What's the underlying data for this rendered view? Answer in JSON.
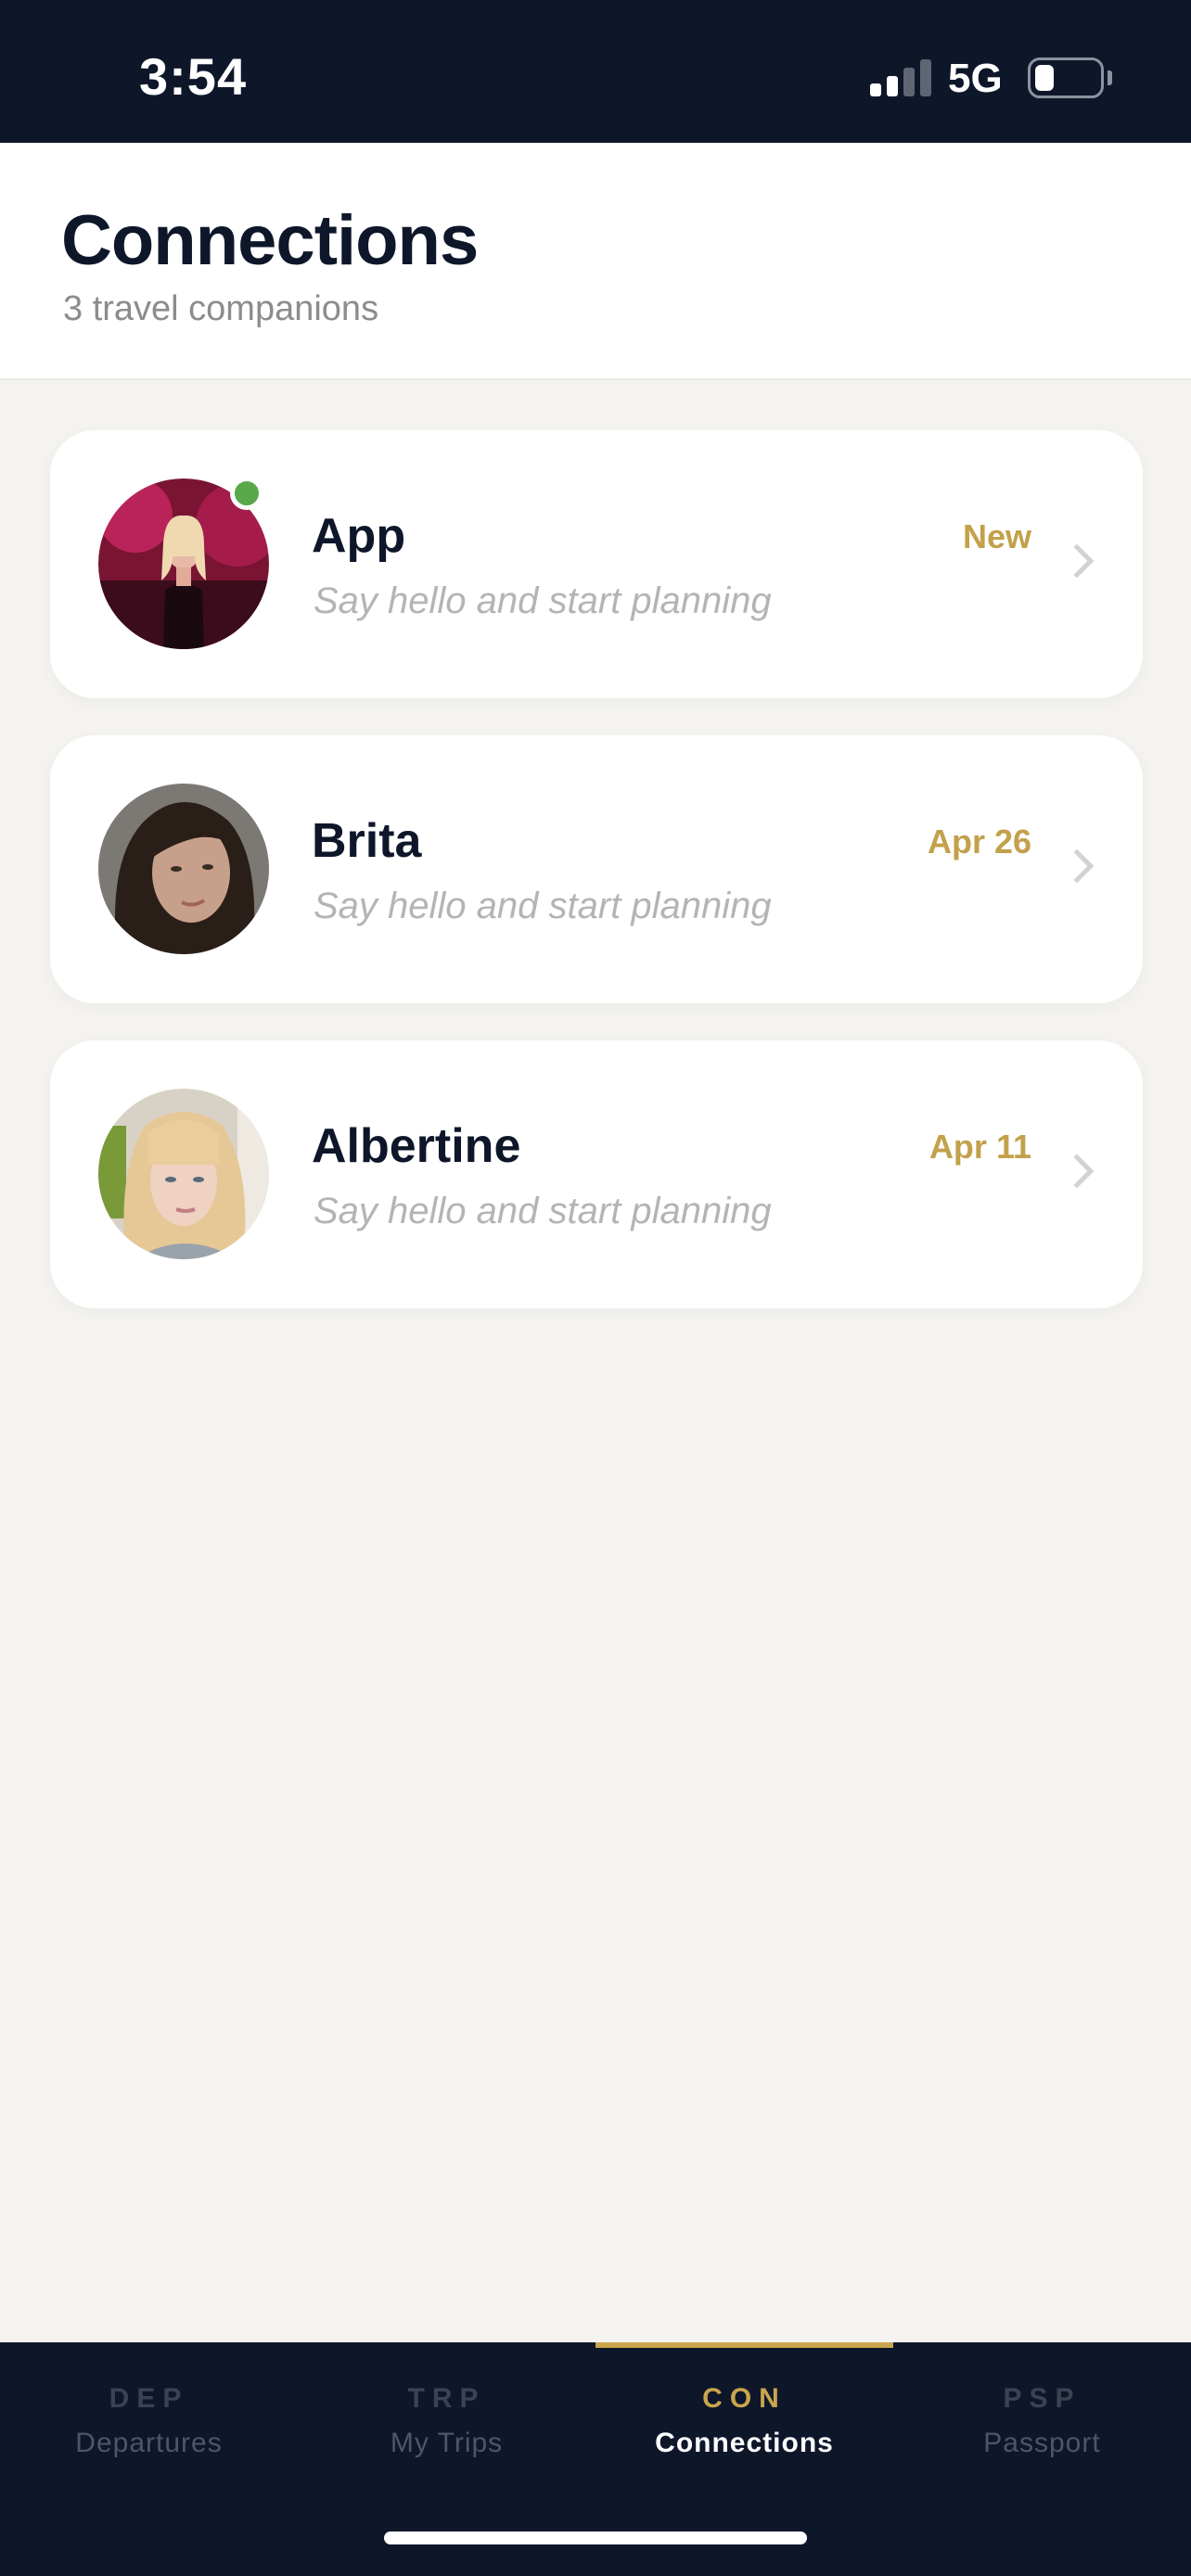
{
  "status_bar": {
    "time": "3:54",
    "network": "5G",
    "battery_level": 0.3
  },
  "header": {
    "title": "Connections",
    "subtitle": "3 travel companions"
  },
  "connections": [
    {
      "name": "App",
      "snippet": "Say hello and start planning",
      "date": "New",
      "online": true,
      "avatar": "person-portrait-pink-backdrop"
    },
    {
      "name": "Brita",
      "snippet": "Say hello and start planning",
      "date": "Apr 26",
      "online": false,
      "avatar": "person-portrait-dark-hair"
    },
    {
      "name": "Albertine",
      "snippet": "Say hello and start planning",
      "date": "Apr 11",
      "online": false,
      "avatar": "person-portrait-blonde-hair"
    }
  ],
  "tabbar": {
    "tabs": [
      {
        "code": "DEP",
        "label": "Departures",
        "active": false
      },
      {
        "code": "TRP",
        "label": "My Trips",
        "active": false
      },
      {
        "code": "CON",
        "label": "Connections",
        "active": true
      },
      {
        "code": "PSP",
        "label": "Passport",
        "active": false
      }
    ]
  },
  "colors": {
    "navy": "#0e172a",
    "gold": "#c9a54d",
    "online_green": "#5aa84c",
    "background": "#f4f3f0"
  }
}
